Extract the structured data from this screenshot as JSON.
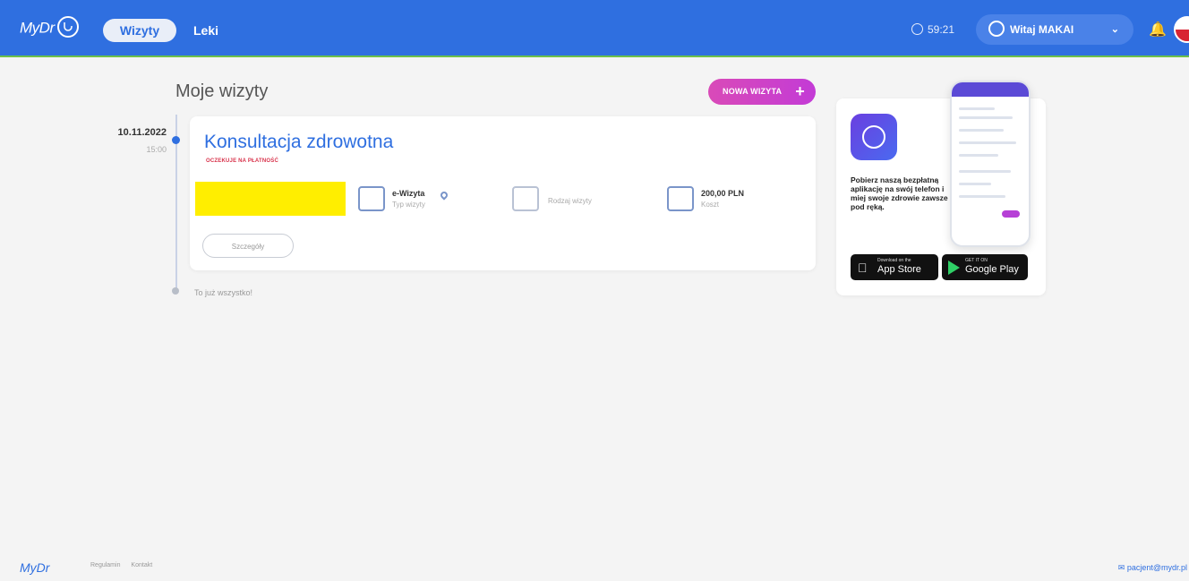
{
  "header": {
    "logo_text": "MyDr",
    "nav_active": "Wizyty",
    "nav_link": "Leki",
    "session_time": "59:21",
    "user_greeting": "Witaj MAKAI",
    "colors": {
      "topbar": "#2f6fe0",
      "accent_green": "#6cc04a"
    }
  },
  "main": {
    "page_title": "Moje wizyty",
    "new_visit_button": "NOWA WIZYTA",
    "timeline": {
      "date": "10.11.2022",
      "date_sub": "15:00",
      "end_text": "To już wszystko!"
    },
    "visit_card": {
      "title": "Konsultacja zdrowotna",
      "status": "OCZEKUJE NA PŁATNOŚĆ",
      "visit_type_value": "e-Wizyta",
      "visit_type_label": "Typ wizyty",
      "visit_kind_label": "Rodzaj wizyty",
      "cost_value": "200,00 PLN",
      "cost_label": "Koszt",
      "details_button": "Szczegóły"
    }
  },
  "promo": {
    "text": "Pobierz naszą bezpłatną aplikację na swój telefon i miej swoje zdrowie zawsze pod ręką.",
    "app_store_small": "Download on the",
    "app_store_big": "App Store",
    "google_play_small": "GET IT ON",
    "google_play_big": "Google Play"
  },
  "footer": {
    "logo_text": "MyDr",
    "link_terms": "Regulamin",
    "link_contact": "Kontakt",
    "email": "pacjent@mydr.pl"
  }
}
